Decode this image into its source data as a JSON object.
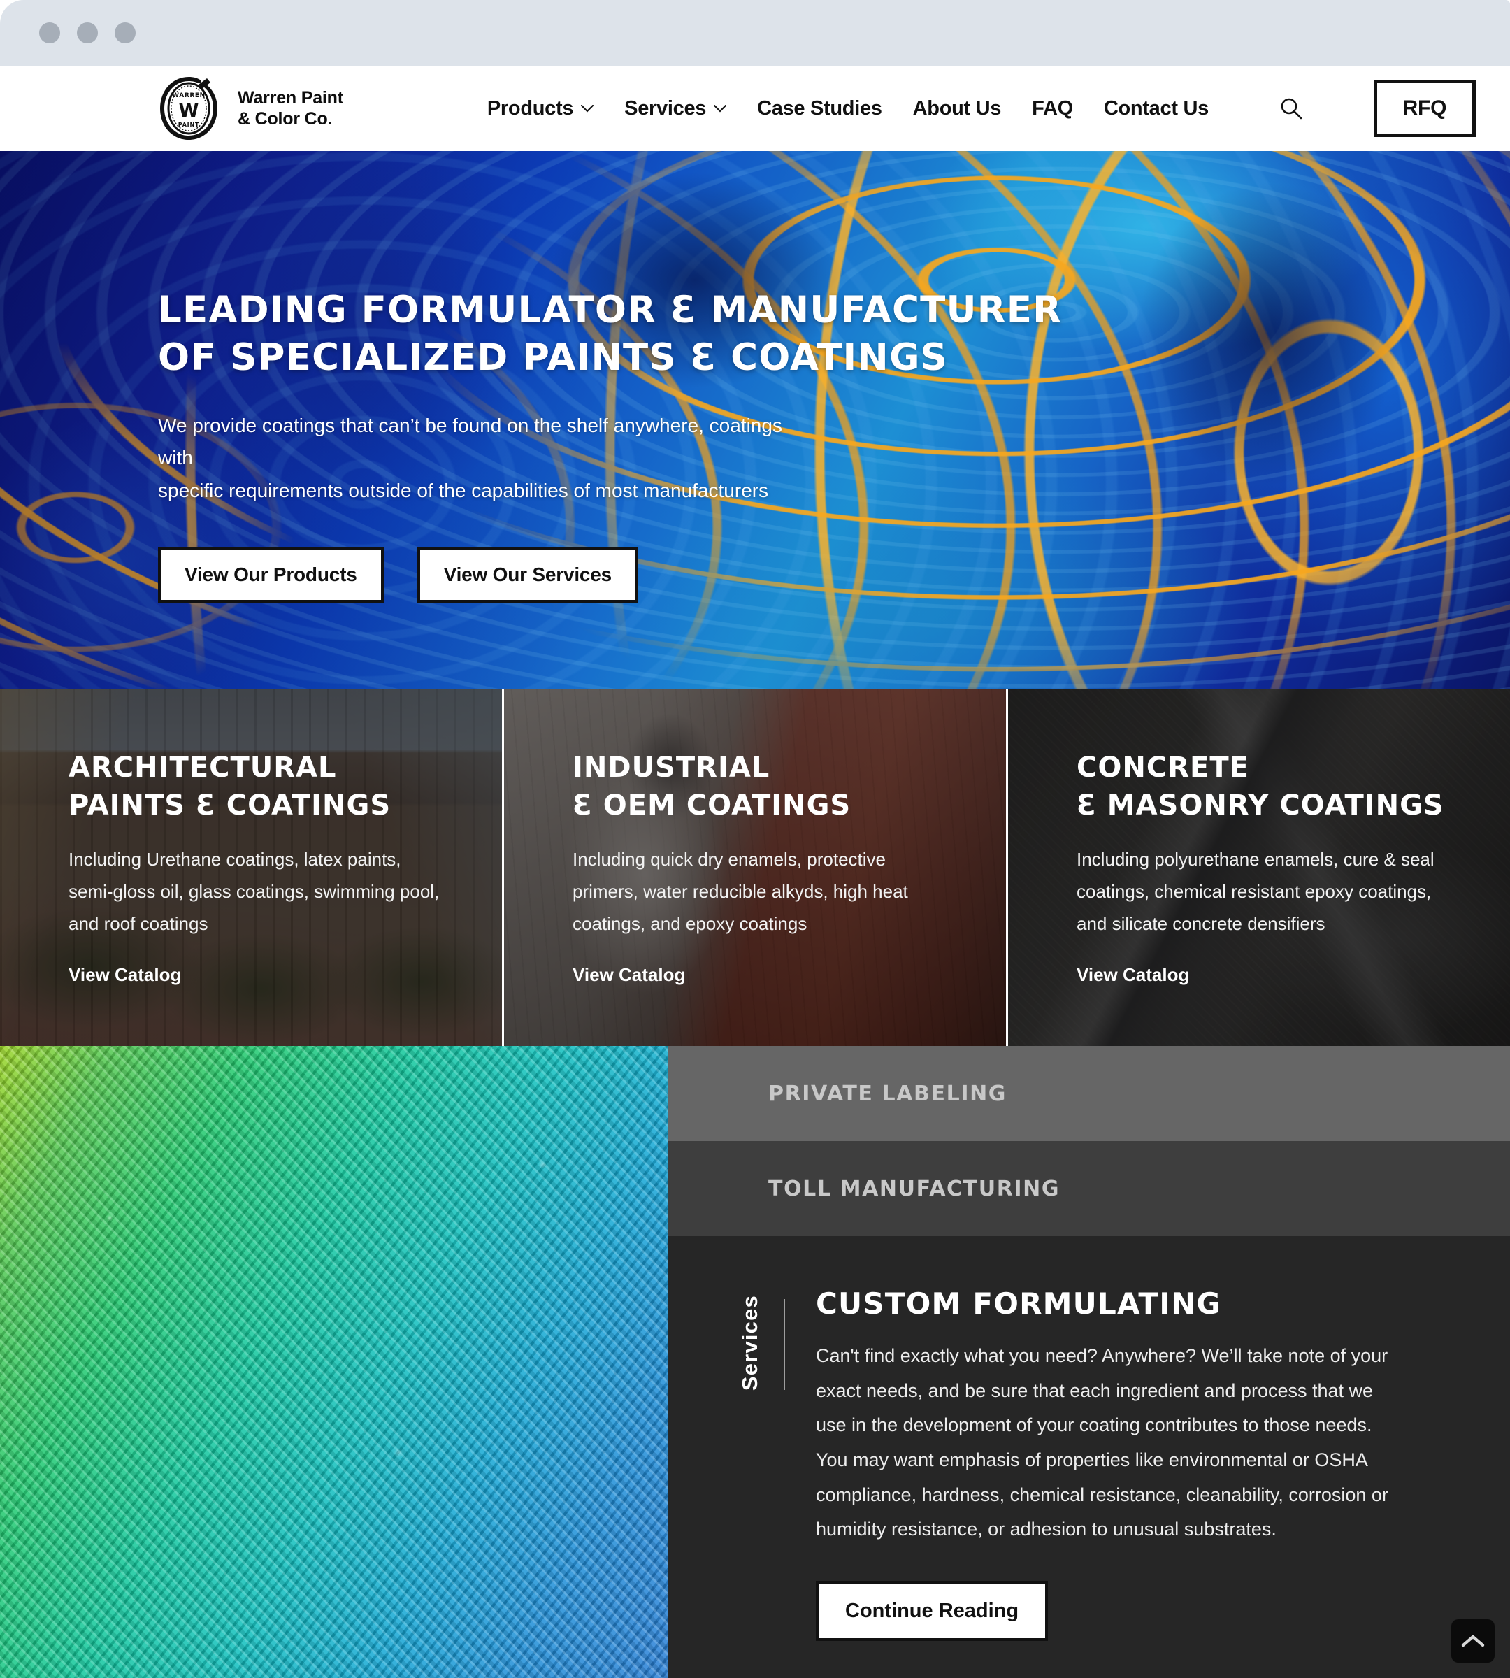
{
  "header": {
    "brand_name": "Warren Paint\n& Color Co.",
    "logo_top_text": "WARREN",
    "logo_center_text": "W",
    "logo_bottom_text": "PAINT",
    "nav": [
      {
        "label": "Products",
        "has_dropdown": true
      },
      {
        "label": "Services",
        "has_dropdown": true
      },
      {
        "label": "Case Studies",
        "has_dropdown": false
      },
      {
        "label": "About Us",
        "has_dropdown": false
      },
      {
        "label": "FAQ",
        "has_dropdown": false
      },
      {
        "label": "Contact Us",
        "has_dropdown": false
      }
    ],
    "search_icon": "search-icon",
    "rfq_label": "RFQ"
  },
  "hero": {
    "title": "LEADING FORMULATOR Ɛ MANUFACTURER\nOF SPECIALIZED PAINTS Ɛ COATINGS",
    "subtitle": "We provide coatings that can’t be found on the shelf anywhere, coatings with\nspecific requirements outside of the capabilities of most manufacturers",
    "primary_button": "View Our Products",
    "secondary_button": "View Our Services"
  },
  "categories": [
    {
      "title": "ARCHITECTURAL\nPAINTS Ɛ COATINGS",
      "description": "Including Urethane coatings, latex paints,\nsemi-gloss oil, glass coatings, swimming pool,\nand roof coatings",
      "link_label": "View Catalog"
    },
    {
      "title": "INDUSTRIAL\nƐ OEM COATINGS",
      "description": "Including quick dry enamels, protective\nprimers, water reducible alkyds, high heat\ncoatings, and epoxy coatings",
      "link_label": "View Catalog"
    },
    {
      "title": "CONCRETE\nƐ MASONRY COATINGS",
      "description": "Including polyurethane enamels, cure & seal\ncoatings, chemical resistant epoxy coatings,\nand silicate concrete densifiers",
      "link_label": "View Catalog"
    }
  ],
  "services": {
    "section_label": "Services",
    "collapsed": [
      {
        "title": "PRIVATE LABELING"
      },
      {
        "title": "TOLL MANUFACTURING"
      }
    ],
    "expanded": {
      "title": "CUSTOM FORMULATING",
      "body": "Can't find exactly what you need? Anywhere? We’ll take note of your exact needs, and be sure that each ingredient and process that we use in the development of your coating contributes to those needs. You may want emphasis of properties like environmental or OSHA compliance, hardness, chemical resistance, cleanability, corrosion or humidity resistance, or adhesion to unusual substrates.",
      "button_label": "Continue Reading"
    }
  },
  "scroll_top": {
    "icon": "chevron-up-icon"
  },
  "colors": {
    "accent_gold": "#f7a71e",
    "hero_blue": "#0c3fbd",
    "collapsed_row_1": "#666666",
    "collapsed_row_2": "#3e3e3e",
    "expanded_panel": "#262626",
    "chrome_bar": "#dde3ea",
    "chrome_dot": "#a6aeb8"
  }
}
